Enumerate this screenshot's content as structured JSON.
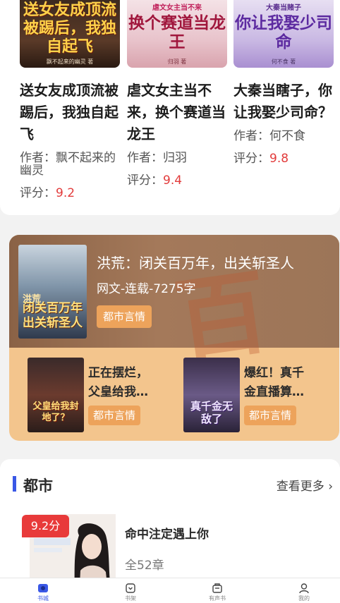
{
  "top_books": [
    {
      "cover_title": "送女友成顶流被踢后，我独自起飞",
      "cover_author": "飘不起来的幽灵 著",
      "title": "送女友成顶流被踢后，我独自起飞",
      "author_label": "作者：",
      "author": "飘不起来的幽灵",
      "score_label": "评分：",
      "score": "9.2"
    },
    {
      "cover_sub": "虐文女主当不来",
      "cover_title": "换个赛道当龙王",
      "cover_author": "归羽 著",
      "title": "虐文女主当不来，换个赛道当龙王",
      "author_label": "作者：",
      "author": "归羽",
      "score_label": "评分：",
      "score": "9.4"
    },
    {
      "cover_sub": "大秦当赌子",
      "cover_title": "你让我娶少司命",
      "cover_author": "何不食 著",
      "title": "大秦当瞎子，你让我娶少司命？",
      "author_label": "作者：",
      "author": "何不食",
      "score_label": "评分：",
      "score": "9.8"
    }
  ],
  "featured": {
    "cover_tag": "洪荒",
    "cover_title": "闭关百万年出关斩圣人",
    "title": "洪荒：闭关百万年，出关斩圣人",
    "meta": "网文-连载-7275字",
    "tag": "都市言情",
    "bg_glyph": "百"
  },
  "sub_books": [
    {
      "cover_title": "父皇给我封地了？",
      "title": "正在摆烂，父皇给我…",
      "tag": "都市言情"
    },
    {
      "cover_title": "真千金无敌了",
      "title": "爆红！真千金直播算…",
      "tag": "都市言情"
    }
  ],
  "section": {
    "title": "都市",
    "more": "查看更多 ›",
    "book": {
      "score": "9.2分",
      "title": "命中注定遇上你",
      "meta": "全52章"
    }
  },
  "nav": [
    {
      "label": "书城",
      "icon": "store-icon",
      "active": true
    },
    {
      "label": "书架",
      "icon": "bookshelf-icon",
      "active": false
    },
    {
      "label": "有声书",
      "icon": "audiobook-icon",
      "active": false
    },
    {
      "label": "我的",
      "icon": "profile-icon",
      "active": false
    }
  ],
  "colors": {
    "accent": "#3a58e6",
    "score_red": "#e23b3b",
    "tag_orange": "#eda35b",
    "feature_bg": "#f3c58d"
  }
}
